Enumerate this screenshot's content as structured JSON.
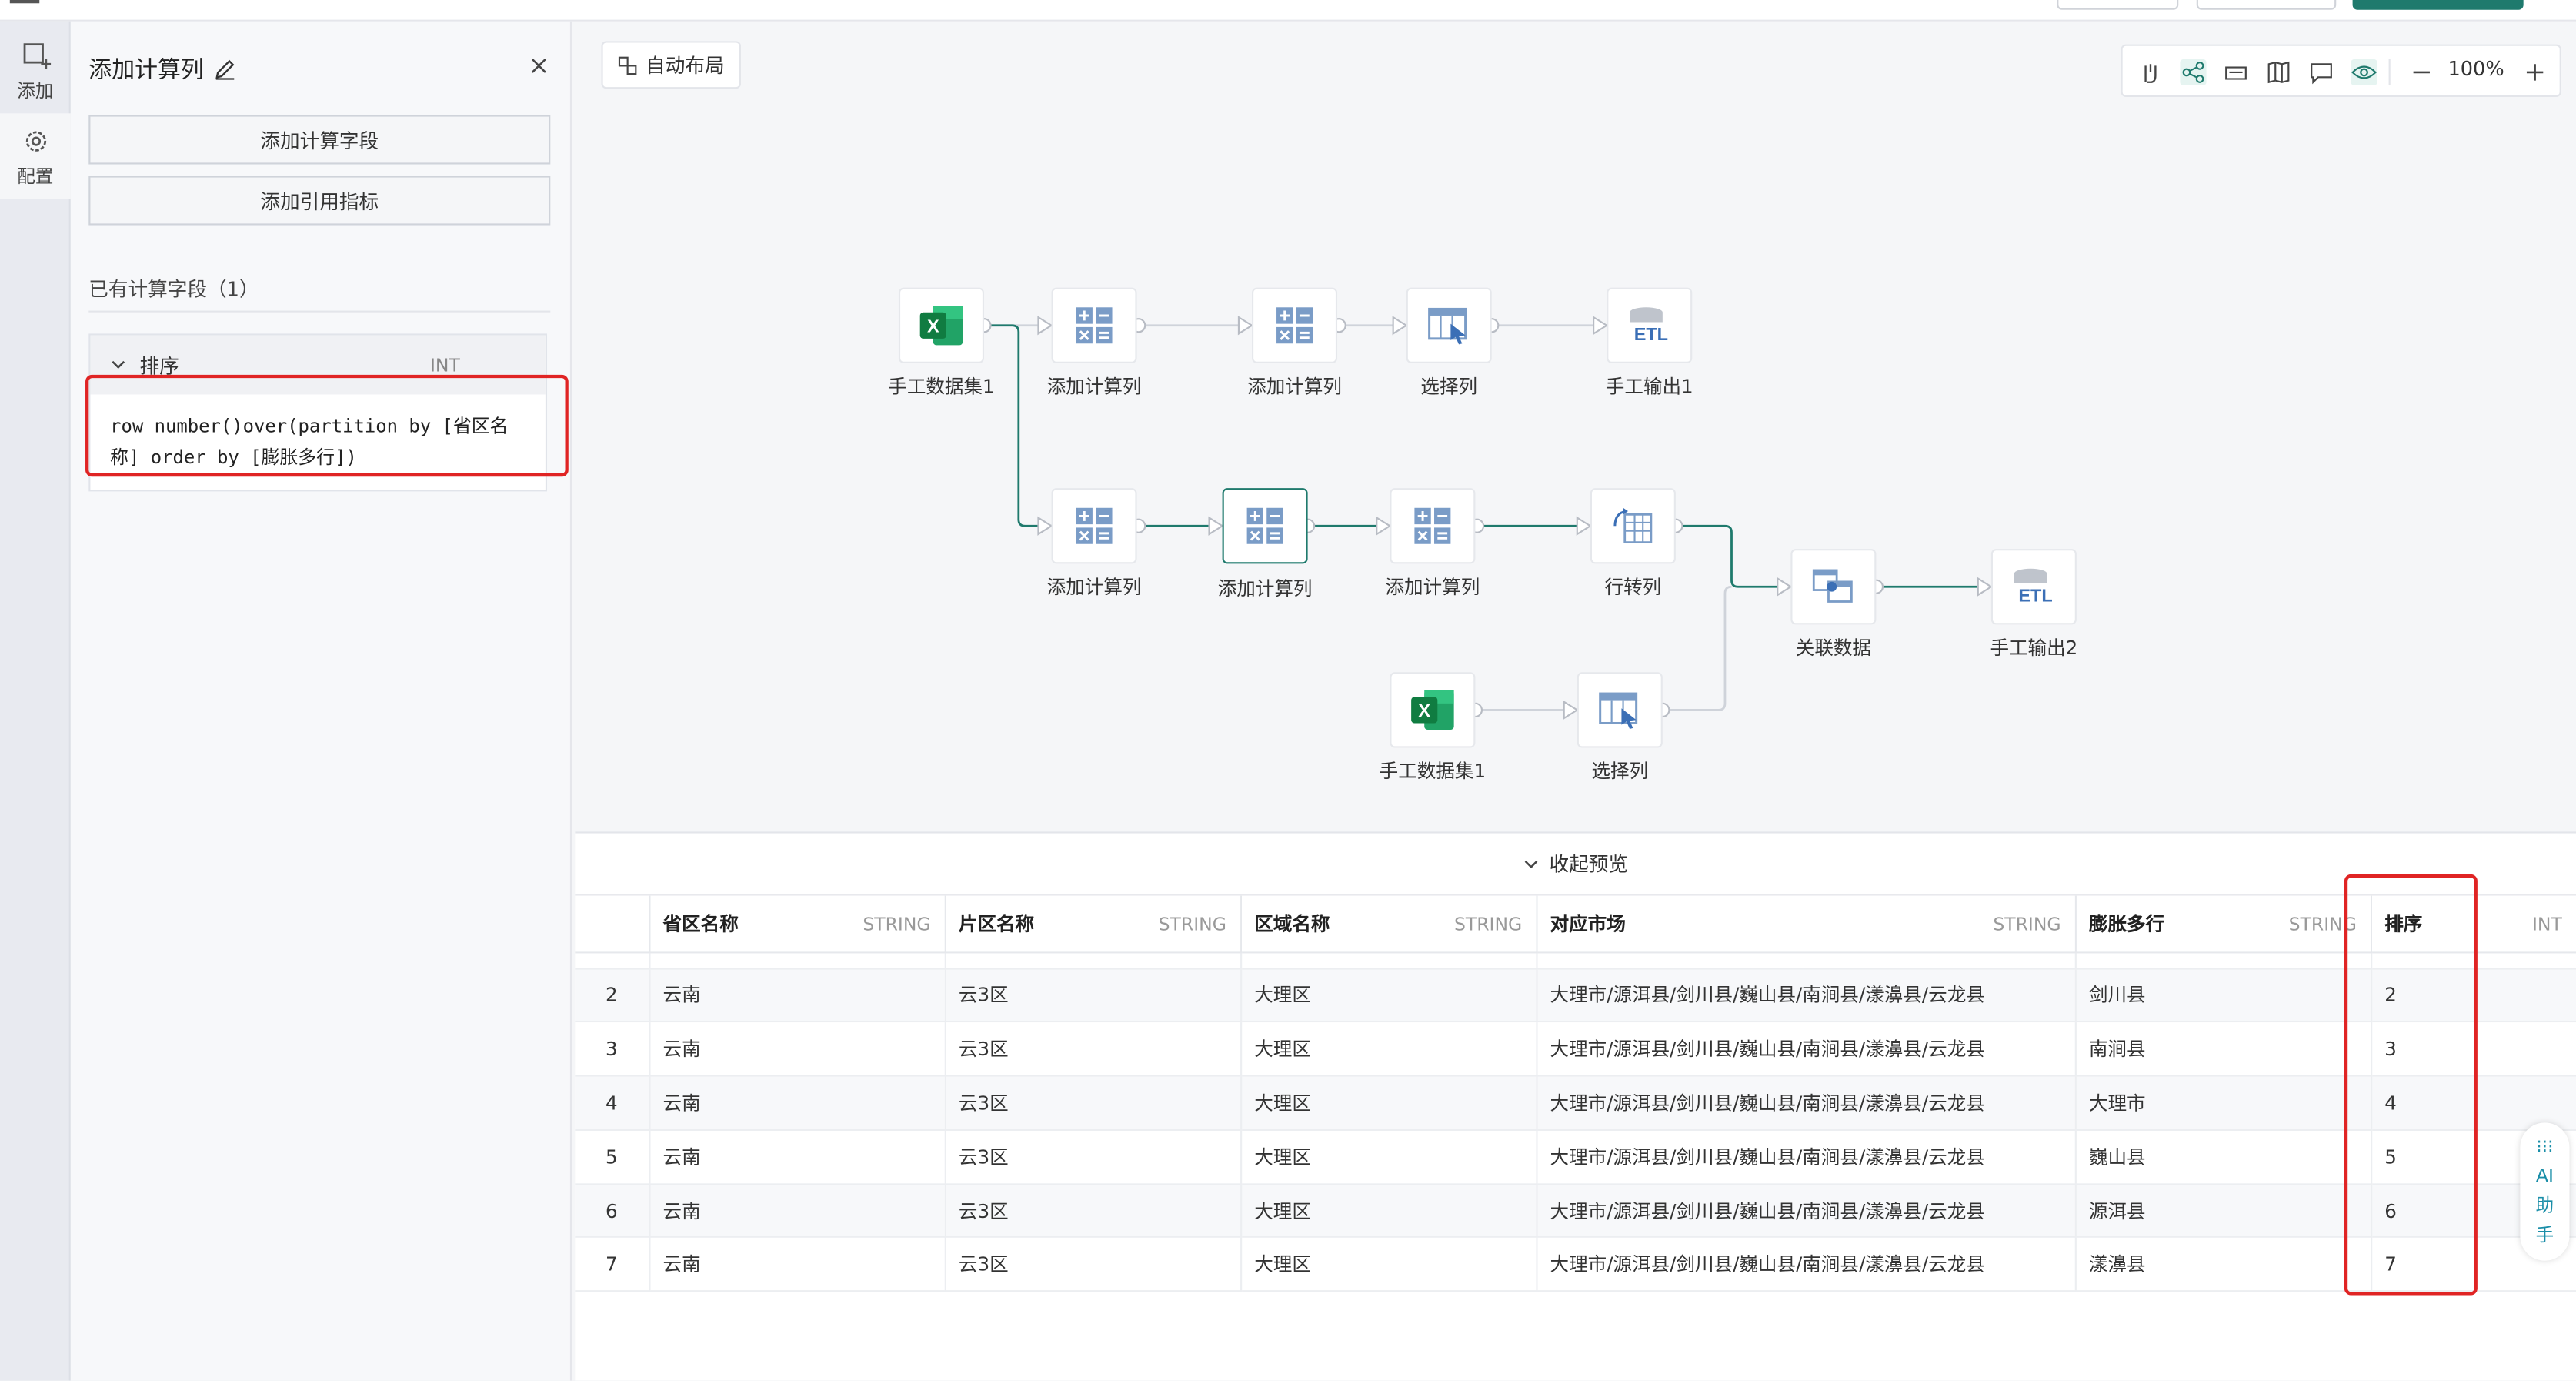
{
  "rail": [
    {
      "label": "添加",
      "icon": "add-node-icon"
    },
    {
      "label": "配置",
      "icon": "gear-icon"
    }
  ],
  "panel": {
    "title": "添加计算列",
    "add_calc_field": "添加计算字段",
    "add_ref_metric": "添加引用指标",
    "existing_label": "已有计算字段（1）",
    "field": {
      "name": "排序",
      "type": "INT",
      "formula": "row_number()over(partition by [省区名称] order by [膨胀多行])"
    }
  },
  "canvas": {
    "auto_layout": "自动布局",
    "zoom": "100%",
    "nodes": [
      {
        "id": "n1",
        "label": "手工数据集1",
        "icon": "excel"
      },
      {
        "id": "n2",
        "label": "添加计算列",
        "icon": "calc"
      },
      {
        "id": "n3",
        "label": "添加计算列",
        "icon": "calc"
      },
      {
        "id": "n4",
        "label": "选择列",
        "icon": "select"
      },
      {
        "id": "n5",
        "label": "手工输出1",
        "icon": "etl"
      },
      {
        "id": "n6",
        "label": "添加计算列",
        "icon": "calc"
      },
      {
        "id": "n7",
        "label": "添加计算列",
        "icon": "calc"
      },
      {
        "id": "n8",
        "label": "添加计算列",
        "icon": "calc"
      },
      {
        "id": "n9",
        "label": "行转列",
        "icon": "pivot"
      },
      {
        "id": "n10",
        "label": "关联数据",
        "icon": "join"
      },
      {
        "id": "n11",
        "label": "手工输出2",
        "icon": "etl"
      },
      {
        "id": "n12",
        "label": "手工数据集1",
        "icon": "excel"
      },
      {
        "id": "n13",
        "label": "选择列",
        "icon": "select"
      }
    ]
  },
  "preview": {
    "collapse_label": "收起预览",
    "columns": [
      {
        "name": "省区名称",
        "type": "STRING"
      },
      {
        "name": "片区名称",
        "type": "STRING"
      },
      {
        "name": "区域名称",
        "type": "STRING"
      },
      {
        "name": "对应市场",
        "type": "STRING"
      },
      {
        "name": "膨胀多行",
        "type": "STRING"
      },
      {
        "name": "排序",
        "type": "INT"
      }
    ],
    "rows": [
      [
        "2",
        "云南",
        "云3区",
        "大理区",
        "大理市/源洱县/剑川县/巍山县/南涧县/漾濞县/云龙县",
        "剑川县",
        "2"
      ],
      [
        "3",
        "云南",
        "云3区",
        "大理区",
        "大理市/源洱县/剑川县/巍山县/南涧县/漾濞县/云龙县",
        "南涧县",
        "3"
      ],
      [
        "4",
        "云南",
        "云3区",
        "大理区",
        "大理市/源洱县/剑川县/巍山县/南涧县/漾濞县/云龙县",
        "大理市",
        "4"
      ],
      [
        "5",
        "云南",
        "云3区",
        "大理区",
        "大理市/源洱县/剑川县/巍山县/南涧县/漾濞县/云龙县",
        "巍山县",
        "5"
      ],
      [
        "6",
        "云南",
        "云3区",
        "大理区",
        "大理市/源洱县/剑川县/巍山县/南涧县/漾濞县/云龙县",
        "源洱县",
        "6"
      ],
      [
        "7",
        "云南",
        "云3区",
        "大理区",
        "大理市/源洱县/剑川县/巍山县/南涧县/漾濞县/云龙县",
        "漾濞县",
        "7"
      ]
    ]
  },
  "ai_assistant": {
    "glyph": "⁝⁝⁝",
    "l1": "AI",
    "l2": "助",
    "l3": "手"
  },
  "colors": {
    "accent": "#1f7a6d",
    "highlight": "#e02424"
  }
}
